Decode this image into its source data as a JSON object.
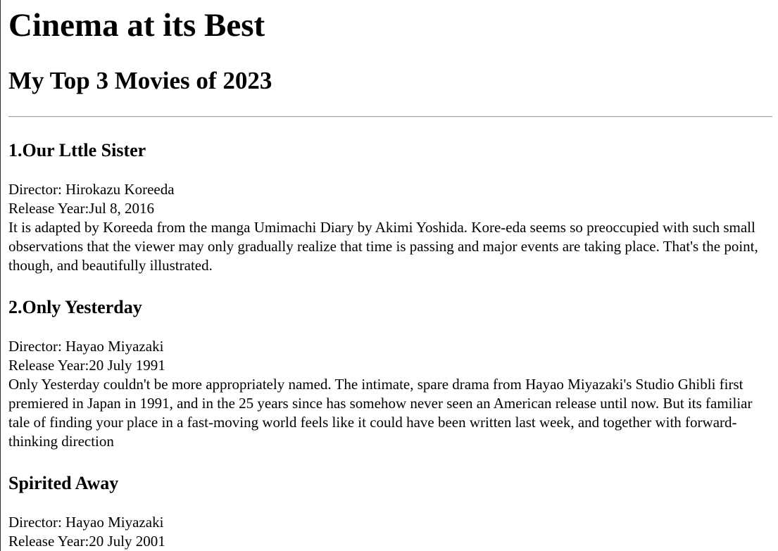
{
  "header": {
    "title": "Cinema at its Best",
    "subtitle": "My Top 3 Movies of 2023"
  },
  "movies": [
    {
      "heading": "1.Our Lttle Sister",
      "director": "Director: Hirokazu Koreeda",
      "release": "Release Year:Jul 8, 2016",
      "description": "It is adapted by Koreeda from the manga Umimachi Diary by Akimi Yoshida. Kore-eda seems so preoccupied with such small observations that the viewer may only gradually realize that time is passing and major events are taking place. That's the point, though, and beautifully illustrated."
    },
    {
      "heading": "2.Only Yesterday",
      "director": "Director: Hayao Miyazaki",
      "release": "Release Year:20 July 1991",
      "description": "Only Yesterday couldn't be more appropriately named. The intimate, spare drama from Hayao Miyazaki's Studio Ghibli first premiered in Japan in 1991, and in the 25 years since has somehow never seen an American release until now. But its familiar tale of finding your place in a fast-moving world feels like it could have been written last week, and together with forward-thinking direction"
    },
    {
      "heading": "Spirited Away",
      "director": "Director: Hayao Miyazaki",
      "release": "Release Year:20 July 2001"
    }
  ]
}
